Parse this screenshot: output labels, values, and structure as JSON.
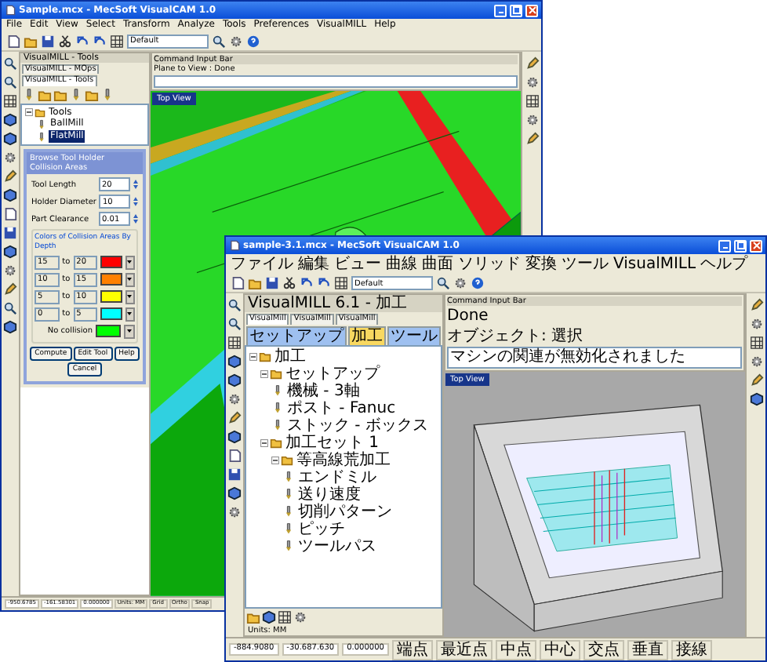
{
  "back_window": {
    "title": "Sample.mcx - MecSoft VisualCAM 1.0",
    "menus": [
      "File",
      "Edit",
      "View",
      "Select",
      "Transform",
      "Analyze",
      "Tools",
      "Preferences",
      "VisualMILL",
      "Help"
    ],
    "layer": "Default",
    "panel": {
      "title": "VisualMILL - Tools",
      "tabs": [
        {
          "label": "VisualMILL - MOps",
          "selected": false
        },
        {
          "label": "VisualMILL - Tools",
          "selected": true
        }
      ],
      "tree": [
        {
          "label": "Tools",
          "expanded": true,
          "selected": false,
          "children": [
            {
              "label": "BallMill",
              "selected": false
            },
            {
              "label": "FlatMill",
              "selected": true
            }
          ]
        }
      ]
    },
    "dialog": {
      "title": "Browse Tool Holder Collision Areas",
      "fields": [
        {
          "label": "Tool Length",
          "value": "20"
        },
        {
          "label": "Holder Diameter",
          "value": "10"
        },
        {
          "label": "Part Clearance",
          "value": "0.01"
        }
      ],
      "depth_group": "Colors of Collision Areas By Depth",
      "depth_colors": [
        {
          "from": "15",
          "to_label": "to",
          "to": "20",
          "color": "#ff0000"
        },
        {
          "from": "10",
          "to_label": "to",
          "to": "15",
          "color": "#ff8000"
        },
        {
          "from": "5",
          "to_label": "to",
          "to": "10",
          "color": "#ffff00"
        },
        {
          "from": "0",
          "to_label": "to",
          "to": "5",
          "color": "#00ffff"
        }
      ],
      "no_collision": {
        "label": "No collision",
        "color": "#00ff00"
      },
      "buttons": [
        "Compute",
        "Edit Tool",
        "Help",
        "Cancel"
      ]
    },
    "command": {
      "title": "Command Input Bar",
      "lines": [
        "Plane to View : Done"
      ]
    },
    "view_label": "Top View",
    "status": [
      "-950.6785",
      "-161.58301",
      "0.000000",
      "Units: MM",
      "Grid",
      "Ortho",
      "Snap"
    ]
  },
  "front_window": {
    "title": "sample-3.1.mcx - MecSoft VisualCAM 1.0",
    "menus": [
      "ファイル",
      "編集",
      "ビュー",
      "曲線",
      "曲面",
      "ソリッド",
      "変換",
      "ツール",
      "VisualMILL",
      "ヘルプ"
    ],
    "layer": "Default",
    "panel": {
      "title": "VisualMILL 6.1 - 加工",
      "tabs": [
        {
          "label": "VisualMill",
          "selected": true
        },
        {
          "label": "VisualMill",
          "selected": false
        },
        {
          "label": "VisualMill",
          "selected": false
        }
      ],
      "sub_tabs": [
        {
          "label": "セットアップ",
          "selected": false
        },
        {
          "label": "加工",
          "selected": true
        },
        {
          "label": "ツール",
          "selected": false
        }
      ],
      "tree": [
        {
          "label": "加工",
          "expanded": true,
          "children": [
            {
              "label": "セットアップ",
              "expanded": true,
              "children": [
                {
                  "label": "機械 - 3軸"
                },
                {
                  "label": "ポスト - Fanuc"
                },
                {
                  "label": "ストック - ボックス"
                }
              ]
            },
            {
              "label": "加工セット 1",
              "expanded": true,
              "children": [
                {
                  "label": "等高線荒加工",
                  "expanded": true,
                  "children": [
                    {
                      "label": "エンドミル"
                    },
                    {
                      "label": "送り速度"
                    },
                    {
                      "label": "切削パターン"
                    },
                    {
                      "label": "ピッチ"
                    },
                    {
                      "label": "ツールパス"
                    }
                  ]
                }
              ]
            }
          ]
        }
      ],
      "units": "Units: MM"
    },
    "command": {
      "title": "Command Input Bar",
      "lines": [
        "Done",
        "オブジェクト: 選択"
      ],
      "input": "マシンの関連が無効化されました"
    },
    "view_label": "Top View",
    "status": [
      "-884.9080",
      "-30.687.630",
      "0.000000"
    ],
    "snaps": [
      "端点",
      "最近点",
      "中点",
      "中心",
      "交点",
      "垂直",
      "接線"
    ]
  }
}
